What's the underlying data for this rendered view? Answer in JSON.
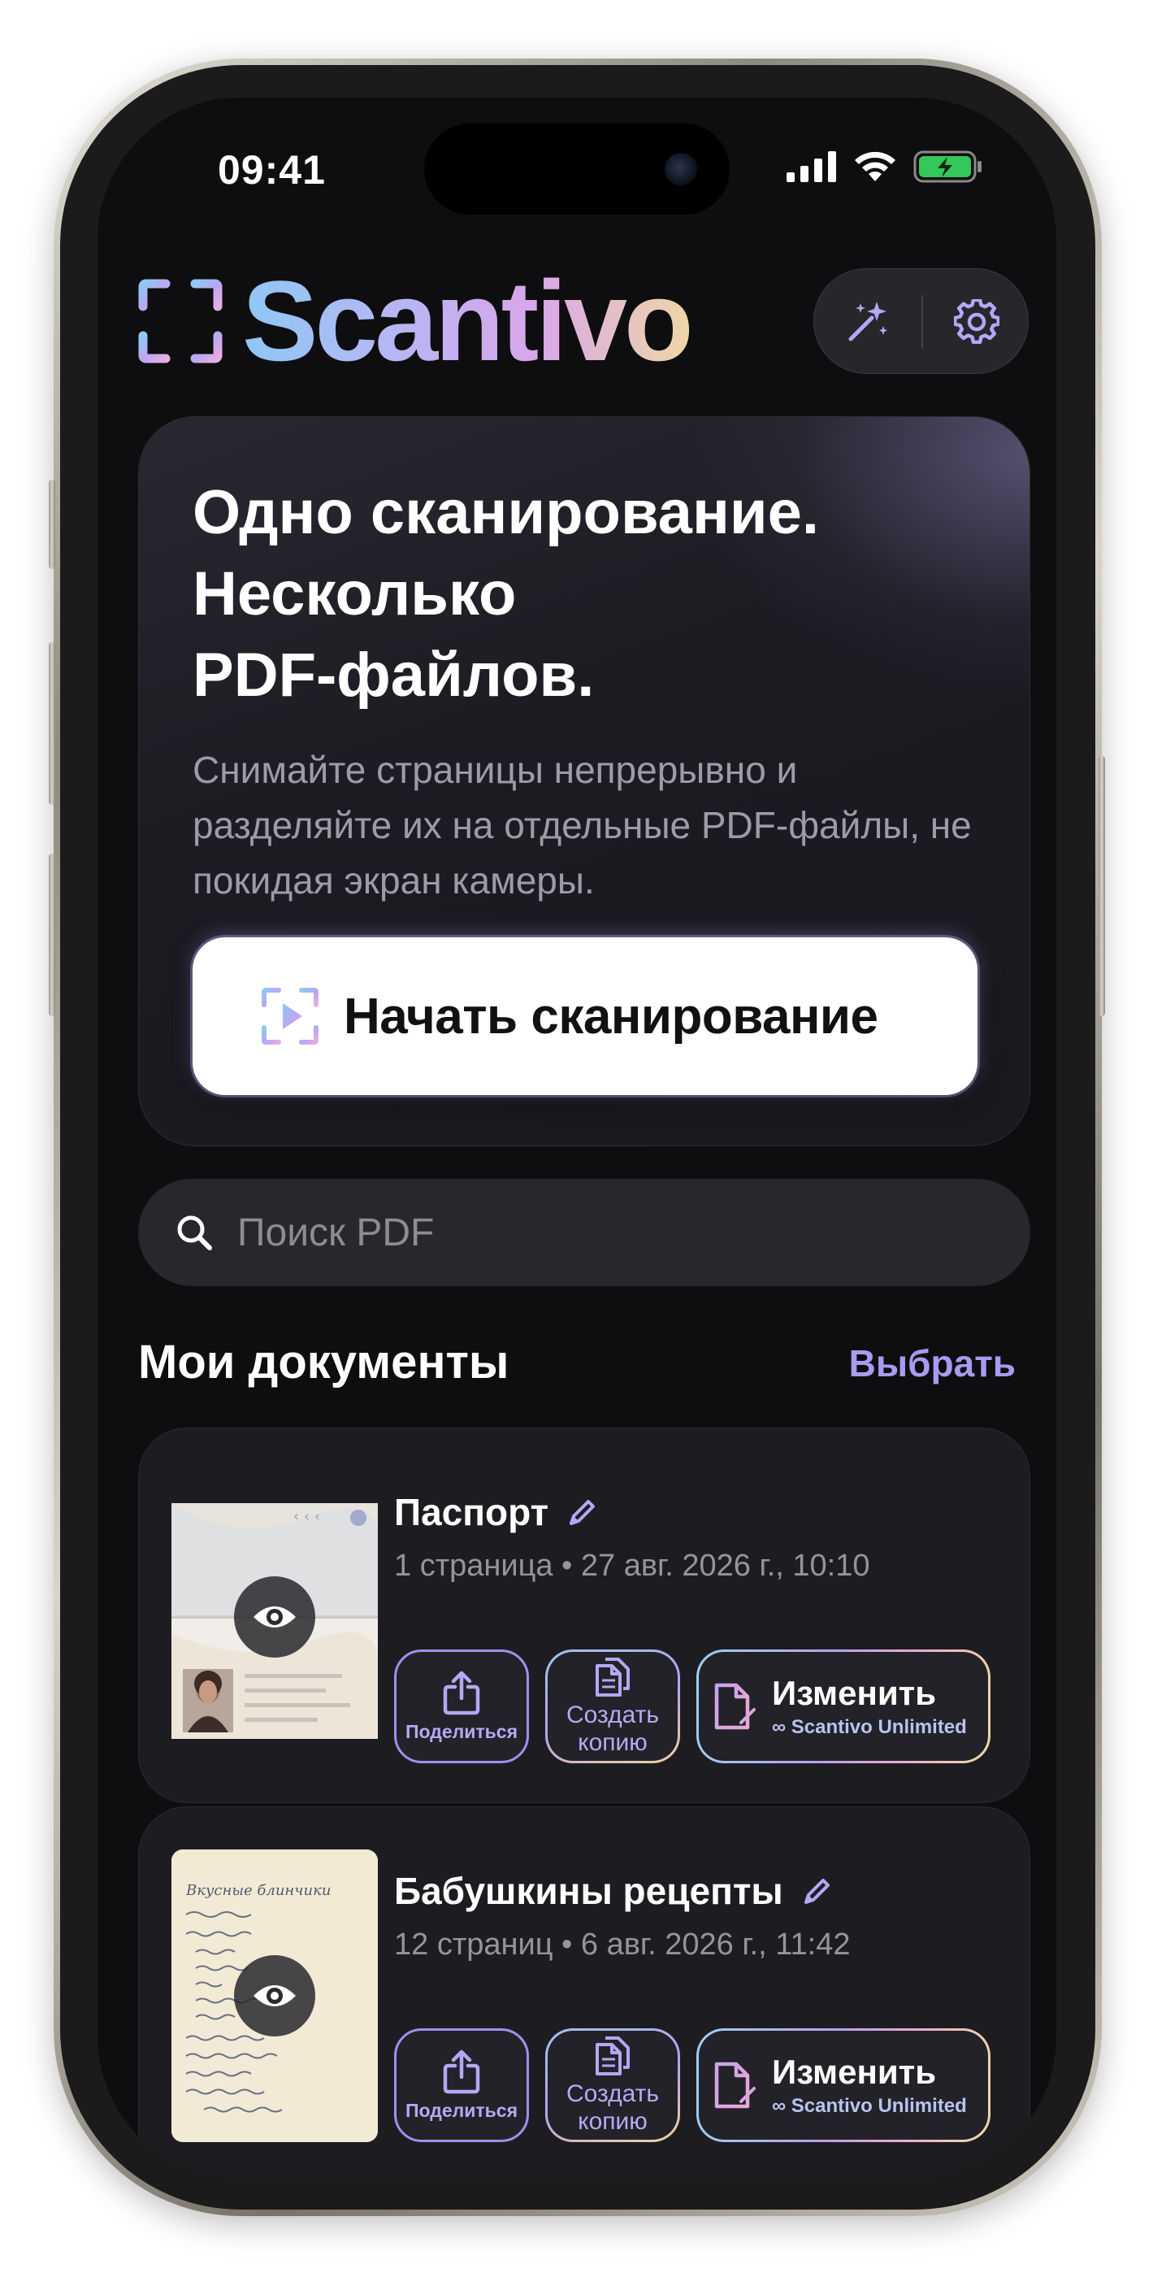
{
  "status_bar": {
    "time": "09:41"
  },
  "header": {
    "app_name": "Scantivo",
    "magic_button_icon": "magic-wand-icon",
    "settings_button_icon": "gear-icon"
  },
  "hero": {
    "title_line1": "Одно сканирование.",
    "title_line2": "Несколько",
    "title_line3": "PDF-файлов.",
    "description": "Снимайте страницы непрерывно и разделяйте их на отдельные PDF-файлы, не покидая экран камеры.",
    "start_button_label": "Начать сканирование"
  },
  "search": {
    "placeholder": "Поиск PDF",
    "value": ""
  },
  "documents_section": {
    "title": "Мои документы",
    "select_label": "Выбрать"
  },
  "documents": [
    {
      "title": "Паспорт",
      "meta": "1 страница • 27 авг. 2026 г., 10:10",
      "share_label": "Поделиться",
      "copy_label_line1": "Создать",
      "copy_label_line2": "копию",
      "edit_label": "Изменить",
      "edit_sub_label": "∞ Scantivo Unlimited"
    },
    {
      "title": "Бабушкины рецепты",
      "meta": "12 страниц • 6 авг. 2026 г., 11:42",
      "share_label": "Поделиться",
      "copy_label_line1": "Создать",
      "copy_label_line2": "копию",
      "edit_label": "Изменить",
      "edit_sub_label": "∞ Scantivo Unlimited"
    }
  ],
  "colors": {
    "background": "#0e0e10",
    "accent": "#a99af0",
    "card": "#1d1d21"
  }
}
